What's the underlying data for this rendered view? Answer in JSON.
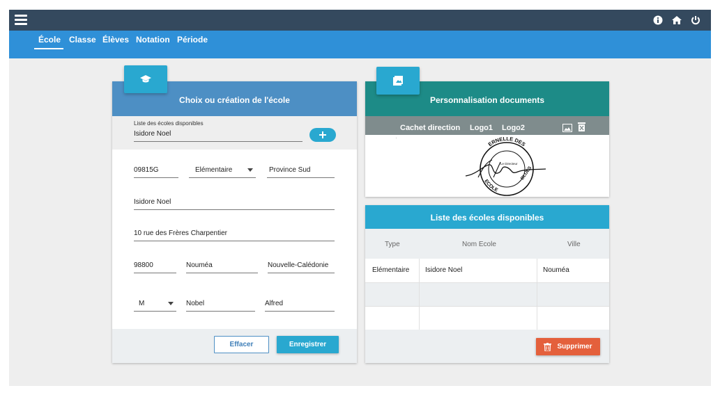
{
  "colors": {
    "topbar": "#34495e",
    "navbar": "#2f90d8",
    "left_card_header": "#4d8fc4",
    "right_top_header": "#1d8b87",
    "right_bottom_header": "#29a8d0",
    "accent_button": "#29a8d0",
    "delete_button": "#e4603c"
  },
  "topbar": {
    "icons": [
      "menu-icon",
      "info-icon",
      "home-icon",
      "power-icon"
    ]
  },
  "nav": {
    "tabs": [
      "École",
      "Classe",
      "Élèves",
      "Notation",
      "Période"
    ],
    "active": "École"
  },
  "school_form": {
    "title": "Choix ou création de l'école",
    "badge_icon": "graduation-cap-icon",
    "select_label": "Liste des écoles disponibles",
    "select_value": "Isidore Noel",
    "add_icon": "plus-icon",
    "code": "09815G",
    "type": "Elémentaire",
    "province": "Province Sud",
    "name": "Isidore Noel",
    "address": "10 rue des Frères Charpentier",
    "postal_code": "98800",
    "city": "Nouméa",
    "country": "Nouvelle-Calédonie",
    "civility": "M",
    "director_lastname": "Nobel",
    "director_firstname": "Alfred",
    "clear_label": "Effacer",
    "save_label": "Enregistrer"
  },
  "documents": {
    "title": "Personnalisation documents",
    "badge_icon": "image-icon",
    "tabs": [
      "Cachet direction",
      "Logo1",
      "Logo2"
    ],
    "active_tab": "Cachet direction",
    "tools": [
      "image-upload-icon",
      "delete-icon"
    ],
    "stamp_text_top": "ERNELLE DES",
    "stamp_text_bottom": "ECOLE",
    "stamp_text_right": "BLUES",
    "stamp_center": "Le Directeur"
  },
  "school_list": {
    "title": "Liste des écoles disponibles",
    "columns": [
      "Type",
      "Nom Ecole",
      "Ville"
    ],
    "rows": [
      [
        "Elémentaire",
        "Isidore Noel",
        "Nouméa"
      ],
      [
        "",
        "",
        ""
      ],
      [
        "",
        "",
        ""
      ]
    ],
    "delete_label": "Supprimer",
    "delete_icon": "trash-icon"
  }
}
